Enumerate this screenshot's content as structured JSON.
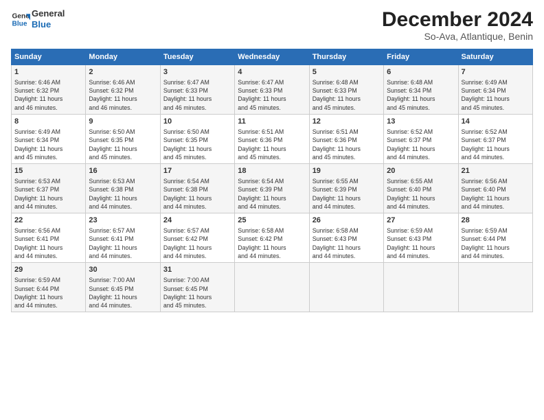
{
  "header": {
    "logo_line1": "General",
    "logo_line2": "Blue",
    "main_title": "December 2024",
    "subtitle": "So-Ava, Atlantique, Benin"
  },
  "days_of_week": [
    "Sunday",
    "Monday",
    "Tuesday",
    "Wednesday",
    "Thursday",
    "Friday",
    "Saturday"
  ],
  "weeks": [
    [
      {
        "day": "1",
        "info": "Sunrise: 6:46 AM\nSunset: 6:32 PM\nDaylight: 11 hours\nand 46 minutes."
      },
      {
        "day": "2",
        "info": "Sunrise: 6:46 AM\nSunset: 6:32 PM\nDaylight: 11 hours\nand 46 minutes."
      },
      {
        "day": "3",
        "info": "Sunrise: 6:47 AM\nSunset: 6:33 PM\nDaylight: 11 hours\nand 46 minutes."
      },
      {
        "day": "4",
        "info": "Sunrise: 6:47 AM\nSunset: 6:33 PM\nDaylight: 11 hours\nand 45 minutes."
      },
      {
        "day": "5",
        "info": "Sunrise: 6:48 AM\nSunset: 6:33 PM\nDaylight: 11 hours\nand 45 minutes."
      },
      {
        "day": "6",
        "info": "Sunrise: 6:48 AM\nSunset: 6:34 PM\nDaylight: 11 hours\nand 45 minutes."
      },
      {
        "day": "7",
        "info": "Sunrise: 6:49 AM\nSunset: 6:34 PM\nDaylight: 11 hours\nand 45 minutes."
      }
    ],
    [
      {
        "day": "8",
        "info": "Sunrise: 6:49 AM\nSunset: 6:34 PM\nDaylight: 11 hours\nand 45 minutes."
      },
      {
        "day": "9",
        "info": "Sunrise: 6:50 AM\nSunset: 6:35 PM\nDaylight: 11 hours\nand 45 minutes."
      },
      {
        "day": "10",
        "info": "Sunrise: 6:50 AM\nSunset: 6:35 PM\nDaylight: 11 hours\nand 45 minutes."
      },
      {
        "day": "11",
        "info": "Sunrise: 6:51 AM\nSunset: 6:36 PM\nDaylight: 11 hours\nand 45 minutes."
      },
      {
        "day": "12",
        "info": "Sunrise: 6:51 AM\nSunset: 6:36 PM\nDaylight: 11 hours\nand 45 minutes."
      },
      {
        "day": "13",
        "info": "Sunrise: 6:52 AM\nSunset: 6:37 PM\nDaylight: 11 hours\nand 44 minutes."
      },
      {
        "day": "14",
        "info": "Sunrise: 6:52 AM\nSunset: 6:37 PM\nDaylight: 11 hours\nand 44 minutes."
      }
    ],
    [
      {
        "day": "15",
        "info": "Sunrise: 6:53 AM\nSunset: 6:37 PM\nDaylight: 11 hours\nand 44 minutes."
      },
      {
        "day": "16",
        "info": "Sunrise: 6:53 AM\nSunset: 6:38 PM\nDaylight: 11 hours\nand 44 minutes."
      },
      {
        "day": "17",
        "info": "Sunrise: 6:54 AM\nSunset: 6:38 PM\nDaylight: 11 hours\nand 44 minutes."
      },
      {
        "day": "18",
        "info": "Sunrise: 6:54 AM\nSunset: 6:39 PM\nDaylight: 11 hours\nand 44 minutes."
      },
      {
        "day": "19",
        "info": "Sunrise: 6:55 AM\nSunset: 6:39 PM\nDaylight: 11 hours\nand 44 minutes."
      },
      {
        "day": "20",
        "info": "Sunrise: 6:55 AM\nSunset: 6:40 PM\nDaylight: 11 hours\nand 44 minutes."
      },
      {
        "day": "21",
        "info": "Sunrise: 6:56 AM\nSunset: 6:40 PM\nDaylight: 11 hours\nand 44 minutes."
      }
    ],
    [
      {
        "day": "22",
        "info": "Sunrise: 6:56 AM\nSunset: 6:41 PM\nDaylight: 11 hours\nand 44 minutes."
      },
      {
        "day": "23",
        "info": "Sunrise: 6:57 AM\nSunset: 6:41 PM\nDaylight: 11 hours\nand 44 minutes."
      },
      {
        "day": "24",
        "info": "Sunrise: 6:57 AM\nSunset: 6:42 PM\nDaylight: 11 hours\nand 44 minutes."
      },
      {
        "day": "25",
        "info": "Sunrise: 6:58 AM\nSunset: 6:42 PM\nDaylight: 11 hours\nand 44 minutes."
      },
      {
        "day": "26",
        "info": "Sunrise: 6:58 AM\nSunset: 6:43 PM\nDaylight: 11 hours\nand 44 minutes."
      },
      {
        "day": "27",
        "info": "Sunrise: 6:59 AM\nSunset: 6:43 PM\nDaylight: 11 hours\nand 44 minutes."
      },
      {
        "day": "28",
        "info": "Sunrise: 6:59 AM\nSunset: 6:44 PM\nDaylight: 11 hours\nand 44 minutes."
      }
    ],
    [
      {
        "day": "29",
        "info": "Sunrise: 6:59 AM\nSunset: 6:44 PM\nDaylight: 11 hours\nand 44 minutes."
      },
      {
        "day": "30",
        "info": "Sunrise: 7:00 AM\nSunset: 6:45 PM\nDaylight: 11 hours\nand 44 minutes."
      },
      {
        "day": "31",
        "info": "Sunrise: 7:00 AM\nSunset: 6:45 PM\nDaylight: 11 hours\nand 45 minutes."
      },
      {
        "day": "",
        "info": ""
      },
      {
        "day": "",
        "info": ""
      },
      {
        "day": "",
        "info": ""
      },
      {
        "day": "",
        "info": ""
      }
    ]
  ]
}
